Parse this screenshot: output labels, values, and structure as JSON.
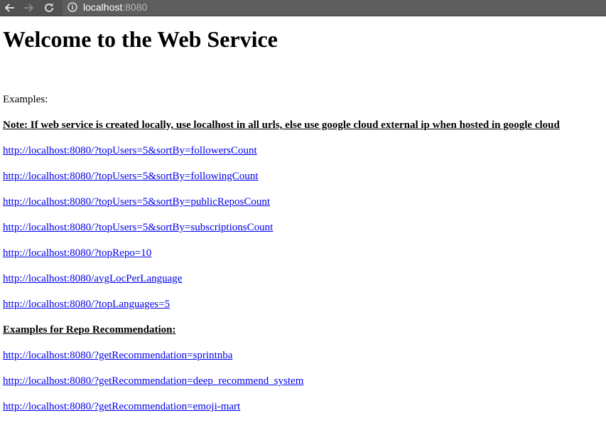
{
  "browser": {
    "url_host": "localhost",
    "url_port": ":8080",
    "icons": {
      "back": "back-arrow-icon",
      "forward": "forward-arrow-icon",
      "reload": "reload-icon",
      "info": "info-icon"
    }
  },
  "page": {
    "title": "Welcome to the Web Service",
    "examples_label": "Examples:",
    "note": "Note: If web service is created locally, use localhost in all urls, else use google cloud external ip when hosted in google cloud",
    "links": [
      "http://localhost:8080/?topUsers=5&sortBy=followersCount",
      "http://localhost:8080/?topUsers=5&sortBy=followingCount",
      "http://localhost:8080/?topUsers=5&sortBy=publicReposCount",
      "http://localhost:8080/?topUsers=5&sortBy=subscriptionsCount",
      "http://localhost:8080/?topRepo=10",
      "http://localhost:8080/avgLocPerLanguage",
      "http://localhost:8080/?topLanguages=5"
    ],
    "recommendation_heading": "Examples for Repo Recommendation:",
    "recommendation_links": [
      "http://localhost:8080/?getRecommendation=sprintnba",
      "http://localhost:8080/?getRecommendation=deep_recommend_system",
      "http://localhost:8080/?getRecommendation=emoji-mart"
    ]
  },
  "colors": {
    "toolbar": "#525252",
    "link": "#0000ee"
  }
}
